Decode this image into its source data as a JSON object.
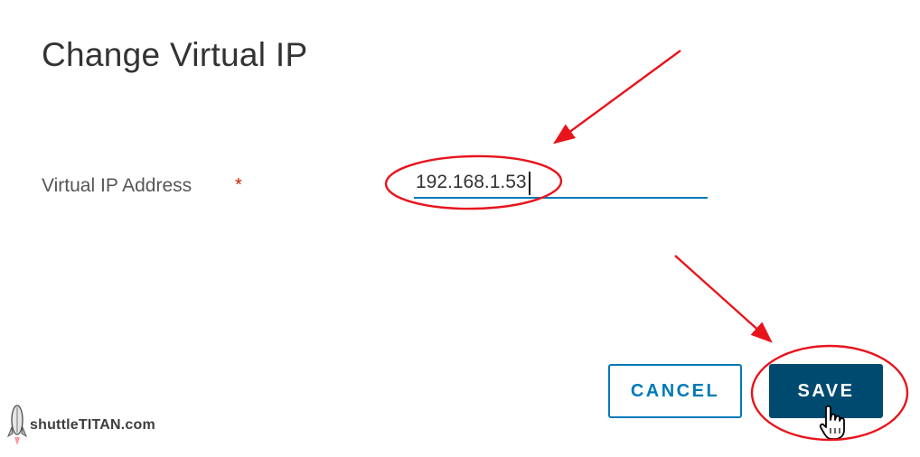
{
  "dialog": {
    "title": "Change Virtual IP",
    "field_label": "Virtual IP Address",
    "required_marker": "*",
    "ip_value": "192.168.1.53",
    "cancel_label": "CANCEL",
    "save_label": "SAVE"
  },
  "watermark": {
    "text": "shuttleTITAN.com",
    "icon": "rocket-icon"
  },
  "annotations": {
    "color": "#e8141c",
    "shapes": [
      "arrow-to-ip-field",
      "ellipse-around-ip-field",
      "arrow-to-save-button",
      "ellipse-around-save-button"
    ]
  },
  "colors": {
    "primary": "#0079b8",
    "save_bg": "#004a70",
    "required": "#c92100"
  }
}
